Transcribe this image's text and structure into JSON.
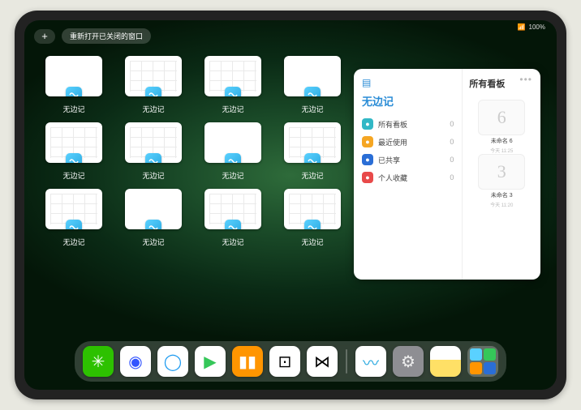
{
  "status": {
    "wifi": "📶",
    "battery": "100%"
  },
  "topbar": {
    "plus_label": "+",
    "reopen_label": "重新打开已关闭的窗口"
  },
  "app": {
    "name": "无边记",
    "windows": [
      {
        "label": "无边记",
        "thumb": "blank"
      },
      {
        "label": "无边记",
        "thumb": "grid"
      },
      {
        "label": "无边记",
        "thumb": "grid"
      },
      {
        "label": "无边记",
        "thumb": "blank"
      },
      {
        "label": "无边记",
        "thumb": "grid"
      },
      {
        "label": "无边记",
        "thumb": "grid"
      },
      {
        "label": "无边记",
        "thumb": "blank"
      },
      {
        "label": "无边记",
        "thumb": "grid"
      },
      {
        "label": "无边记",
        "thumb": "grid"
      },
      {
        "label": "无边记",
        "thumb": "blank"
      },
      {
        "label": "无边记",
        "thumb": "grid"
      },
      {
        "label": "无边记",
        "thumb": "grid"
      }
    ]
  },
  "panel": {
    "title": "无边记",
    "items": [
      {
        "icon_color": "#32b8c6",
        "label": "所有看板",
        "count": "0"
      },
      {
        "icon_color": "#f5a623",
        "label": "最近使用",
        "count": "0"
      },
      {
        "icon_color": "#2a6ed6",
        "label": "已共享",
        "count": "0"
      },
      {
        "icon_color": "#e84a4a",
        "label": "个人收藏",
        "count": "0"
      }
    ],
    "right_title": "所有看板",
    "boards": [
      {
        "glyph": "6",
        "label": "未命名 6",
        "sub": "今天 11:25"
      },
      {
        "glyph": "3",
        "label": "未命名 3",
        "sub": "今天 11:20"
      }
    ]
  },
  "dock": {
    "apps": [
      {
        "name": "wechat-icon",
        "bg": "#2dc100",
        "glyph": "✳"
      },
      {
        "name": "quark-icon",
        "bg": "#ffffff",
        "glyph": "◉",
        "fg": "#3355ff"
      },
      {
        "name": "qqbrowser-icon",
        "bg": "#ffffff",
        "glyph": "◯",
        "fg": "#1e9bf0"
      },
      {
        "name": "play-icon",
        "bg": "#ffffff",
        "glyph": "▶",
        "fg": "#35c759"
      },
      {
        "name": "books-icon",
        "bg": "#ff9500",
        "glyph": "▮▮",
        "fg": "#fff"
      },
      {
        "name": "dice-icon",
        "bg": "#ffffff",
        "glyph": "⊡",
        "fg": "#000"
      },
      {
        "name": "connect-icon",
        "bg": "#ffffff",
        "glyph": "⋈",
        "fg": "#000"
      }
    ],
    "recent": [
      {
        "name": "freeform-icon",
        "bg": "#ffffff",
        "glyph": "〰",
        "fg": "#2aa9e0"
      },
      {
        "name": "settings-icon",
        "bg": "#8e8e93",
        "glyph": "⚙",
        "fg": "#eee"
      },
      {
        "name": "notes-icon",
        "bg": "linear-gradient(#fff 45%,#ffe066 45%)",
        "glyph": "",
        "fg": "#000"
      }
    ],
    "group_colors": [
      "#5ad1ff",
      "#35c759",
      "#ff9500",
      "#2a6ed6"
    ]
  }
}
